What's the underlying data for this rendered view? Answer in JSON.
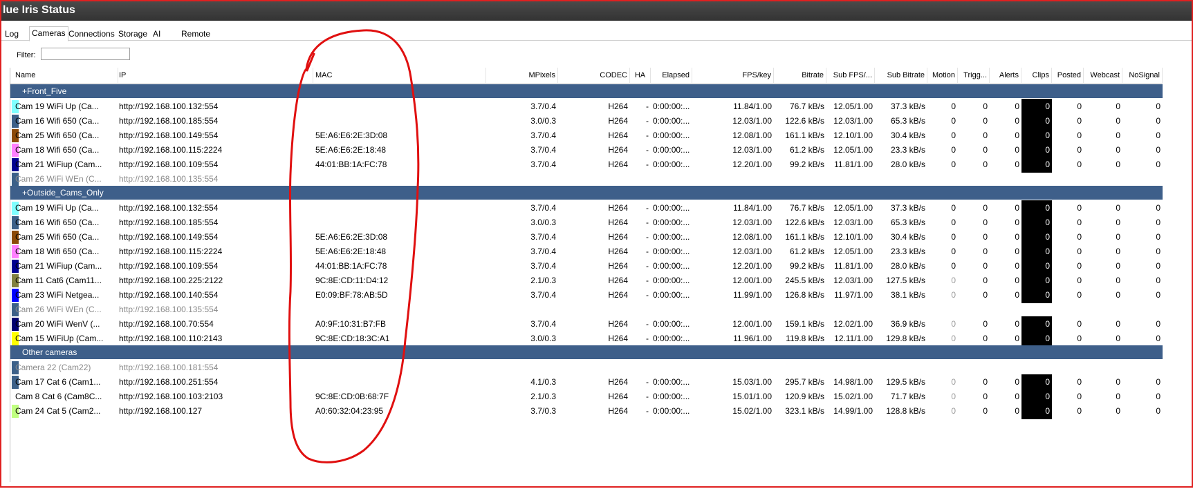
{
  "window": {
    "title": "lue Iris Status"
  },
  "tabs": [
    {
      "label": "Log",
      "active": false
    },
    {
      "label": "Cameras",
      "active": true
    },
    {
      "label": "Connections",
      "active": false
    },
    {
      "label": "Storage",
      "active": false
    },
    {
      "label": "AI",
      "active": false
    },
    {
      "label": "Remote",
      "active": false
    }
  ],
  "filter": {
    "label": "Filter:",
    "value": ""
  },
  "columns": [
    "Name",
    "IP",
    "MAC",
    "MPixels",
    "CODEC",
    "HA",
    "Elapsed",
    "FPS/key",
    "Bitrate",
    "Sub FPS/...",
    "Sub Bitrate",
    "Motion",
    "Trigg...",
    "Alerts",
    "Clips",
    "Posted",
    "Webcast",
    "NoSignal"
  ],
  "groups": [
    {
      "label": "+Front_Five",
      "rows": [
        {
          "color": "#80ffff",
          "disabled": false,
          "name": "Cam 19 WiFi Up (Ca...",
          "ip": "http://192.168.100.132:554",
          "mac": "",
          "mpixels": "3.7/0.4",
          "codec": "H264",
          "ha": "-",
          "elapsed": "0:00:00:...",
          "fps": "11.84/1.00",
          "bitrate": "76.7 kB/s",
          "subfps": "12.05/1.00",
          "subbitrate": "37.3 kB/s",
          "motion": "0",
          "trigg": "0",
          "alerts": "0",
          "clips": "0",
          "posted": "0",
          "webcast": "0",
          "nosignal": "0",
          "dim_motion": false
        },
        {
          "color": "#3c6088",
          "disabled": false,
          "name": "Cam 16 Wifi 650 (Ca...",
          "ip": "http://192.168.100.185:554",
          "mac": "",
          "mpixels": "3.0/0.3",
          "codec": "H264",
          "ha": "-",
          "elapsed": "0:00:00:...",
          "fps": "12.03/1.00",
          "bitrate": "122.6 kB/s",
          "subfps": "12.03/1.00",
          "subbitrate": "65.3 kB/s",
          "motion": "0",
          "trigg": "0",
          "alerts": "0",
          "clips": "0",
          "posted": "0",
          "webcast": "0",
          "nosignal": "0",
          "dim_motion": false
        },
        {
          "color": "#8b4a08",
          "disabled": false,
          "name": "Cam 25 Wifi 650 (Ca...",
          "ip": "http://192.168.100.149:554",
          "mac": "5E:A6:E6:2E:3D:08",
          "mpixels": "3.7/0.4",
          "codec": "H264",
          "ha": "-",
          "elapsed": "0:00:00:...",
          "fps": "12.08/1.00",
          "bitrate": "161.1 kB/s",
          "subfps": "12.10/1.00",
          "subbitrate": "30.4 kB/s",
          "motion": "0",
          "trigg": "0",
          "alerts": "0",
          "clips": "0",
          "posted": "0",
          "webcast": "0",
          "nosignal": "0",
          "dim_motion": false
        },
        {
          "color": "#ff80ff",
          "disabled": false,
          "name": "Cam 18 Wifi 650 (Ca...",
          "ip": "http://192.168.100.115:2224",
          "mac": "5E:A6:E6:2E:18:48",
          "mpixels": "3.7/0.4",
          "codec": "H264",
          "ha": "-",
          "elapsed": "0:00:00:...",
          "fps": "12.03/1.00",
          "bitrate": "61.2 kB/s",
          "subfps": "12.05/1.00",
          "subbitrate": "23.3 kB/s",
          "motion": "0",
          "trigg": "0",
          "alerts": "0",
          "clips": "0",
          "posted": "0",
          "webcast": "0",
          "nosignal": "0",
          "dim_motion": false
        },
        {
          "color": "#000090",
          "disabled": false,
          "name": "Cam 21 WiFiup (Cam...",
          "ip": "http://192.168.100.109:554",
          "mac": "44:01:BB:1A:FC:78",
          "mpixels": "3.7/0.4",
          "codec": "H264",
          "ha": "-",
          "elapsed": "0:00:00:...",
          "fps": "12.20/1.00",
          "bitrate": "99.2 kB/s",
          "subfps": "11.81/1.00",
          "subbitrate": "28.0 kB/s",
          "motion": "0",
          "trigg": "0",
          "alerts": "0",
          "clips": "0",
          "posted": "0",
          "webcast": "0",
          "nosignal": "0",
          "dim_motion": false
        },
        {
          "color": "#3c6088",
          "disabled": true,
          "name": "Cam 26 WiFi WEn (C...",
          "ip": "http://192.168.100.135:554",
          "mac": "",
          "mpixels": "",
          "codec": "",
          "ha": "",
          "elapsed": "",
          "fps": "",
          "bitrate": "",
          "subfps": "",
          "subbitrate": "",
          "motion": "",
          "trigg": "",
          "alerts": "",
          "clips": "",
          "posted": "",
          "webcast": "",
          "nosignal": "",
          "dim_motion": false
        }
      ]
    },
    {
      "label": "+Outside_Cams_Only",
      "rows": [
        {
          "color": "#80ffff",
          "disabled": false,
          "name": "Cam 19 WiFi Up (Ca...",
          "ip": "http://192.168.100.132:554",
          "mac": "",
          "mpixels": "3.7/0.4",
          "codec": "H264",
          "ha": "-",
          "elapsed": "0:00:00:...",
          "fps": "11.84/1.00",
          "bitrate": "76.7 kB/s",
          "subfps": "12.05/1.00",
          "subbitrate": "37.3 kB/s",
          "motion": "0",
          "trigg": "0",
          "alerts": "0",
          "clips": "0",
          "posted": "0",
          "webcast": "0",
          "nosignal": "0",
          "dim_motion": false
        },
        {
          "color": "#3c6088",
          "disabled": false,
          "name": "Cam 16 Wifi 650 (Ca...",
          "ip": "http://192.168.100.185:554",
          "mac": "",
          "mpixels": "3.0/0.3",
          "codec": "H264",
          "ha": "-",
          "elapsed": "0:00:00:...",
          "fps": "12.03/1.00",
          "bitrate": "122.6 kB/s",
          "subfps": "12.03/1.00",
          "subbitrate": "65.3 kB/s",
          "motion": "0",
          "trigg": "0",
          "alerts": "0",
          "clips": "0",
          "posted": "0",
          "webcast": "0",
          "nosignal": "0",
          "dim_motion": false
        },
        {
          "color": "#8b4a08",
          "disabled": false,
          "name": "Cam 25 Wifi 650 (Ca...",
          "ip": "http://192.168.100.149:554",
          "mac": "5E:A6:E6:2E:3D:08",
          "mpixels": "3.7/0.4",
          "codec": "H264",
          "ha": "-",
          "elapsed": "0:00:00:...",
          "fps": "12.08/1.00",
          "bitrate": "161.1 kB/s",
          "subfps": "12.10/1.00",
          "subbitrate": "30.4 kB/s",
          "motion": "0",
          "trigg": "0",
          "alerts": "0",
          "clips": "0",
          "posted": "0",
          "webcast": "0",
          "nosignal": "0",
          "dim_motion": false
        },
        {
          "color": "#ff80ff",
          "disabled": false,
          "name": "Cam 18 Wifi 650 (Ca...",
          "ip": "http://192.168.100.115:2224",
          "mac": "5E:A6:E6:2E:18:48",
          "mpixels": "3.7/0.4",
          "codec": "H264",
          "ha": "-",
          "elapsed": "0:00:00:...",
          "fps": "12.03/1.00",
          "bitrate": "61.2 kB/s",
          "subfps": "12.05/1.00",
          "subbitrate": "23.3 kB/s",
          "motion": "0",
          "trigg": "0",
          "alerts": "0",
          "clips": "0",
          "posted": "0",
          "webcast": "0",
          "nosignal": "0",
          "dim_motion": false
        },
        {
          "color": "#000090",
          "disabled": false,
          "name": "Cam 21 WiFiup (Cam...",
          "ip": "http://192.168.100.109:554",
          "mac": "44:01:BB:1A:FC:78",
          "mpixels": "3.7/0.4",
          "codec": "H264",
          "ha": "-",
          "elapsed": "0:00:00:...",
          "fps": "12.20/1.00",
          "bitrate": "99.2 kB/s",
          "subfps": "11.81/1.00",
          "subbitrate": "28.0 kB/s",
          "motion": "0",
          "trigg": "0",
          "alerts": "0",
          "clips": "0",
          "posted": "0",
          "webcast": "0",
          "nosignal": "0",
          "dim_motion": false
        },
        {
          "color": "#808040",
          "disabled": false,
          "name": "Cam 11 Cat6 (Cam11...",
          "ip": "http://192.168.100.225:2122",
          "mac": "9C:8E:CD:11:D4:12",
          "mpixels": "2.1/0.3",
          "codec": "H264",
          "ha": "-",
          "elapsed": "0:00:00:...",
          "fps": "12.00/1.00",
          "bitrate": "245.5 kB/s",
          "subfps": "12.03/1.00",
          "subbitrate": "127.5 kB/s",
          "motion": "0",
          "trigg": "0",
          "alerts": "0",
          "clips": "0",
          "posted": "0",
          "webcast": "0",
          "nosignal": "0",
          "dim_motion": true
        },
        {
          "color": "#0000ff",
          "disabled": false,
          "name": "Cam 23 WiFi Netgea...",
          "ip": "http://192.168.100.140:554",
          "mac": "E0:09:BF:78:AB:5D",
          "mpixels": "3.7/0.4",
          "codec": "H264",
          "ha": "-",
          "elapsed": "0:00:00:...",
          "fps": "11.99/1.00",
          "bitrate": "126.8 kB/s",
          "subfps": "11.97/1.00",
          "subbitrate": "38.1 kB/s",
          "motion": "0",
          "trigg": "0",
          "alerts": "0",
          "clips": "0",
          "posted": "0",
          "webcast": "0",
          "nosignal": "0",
          "dim_motion": true
        },
        {
          "color": "#3c6088",
          "disabled": true,
          "name": "Cam 26 WiFi WEn (C...",
          "ip": "http://192.168.100.135:554",
          "mac": "",
          "mpixels": "",
          "codec": "",
          "ha": "",
          "elapsed": "",
          "fps": "",
          "bitrate": "",
          "subfps": "",
          "subbitrate": "",
          "motion": "",
          "trigg": "",
          "alerts": "",
          "clips": "",
          "posted": "",
          "webcast": "",
          "nosignal": "",
          "dim_motion": false
        },
        {
          "color": "#000070",
          "disabled": false,
          "name": "Cam 20 WiFi WenV (...",
          "ip": "http://192.168.100.70:554",
          "mac": "A0:9F:10:31:B7:FB",
          "mpixels": "3.7/0.4",
          "codec": "H264",
          "ha": "-",
          "elapsed": "0:00:00:...",
          "fps": "12.00/1.00",
          "bitrate": "159.1 kB/s",
          "subfps": "12.02/1.00",
          "subbitrate": "36.9 kB/s",
          "motion": "0",
          "trigg": "0",
          "alerts": "0",
          "clips": "0",
          "posted": "0",
          "webcast": "0",
          "nosignal": "0",
          "dim_motion": true
        },
        {
          "color": "#ffff00",
          "disabled": false,
          "name": "Cam 15  WiFiUp (Cam...",
          "ip": "http://192.168.100.110:2143",
          "mac": "9C:8E:CD:18:3C:A1",
          "mpixels": "3.0/0.3",
          "codec": "H264",
          "ha": "-",
          "elapsed": "0:00:00:...",
          "fps": "11.96/1.00",
          "bitrate": "119.8 kB/s",
          "subfps": "12.11/1.00",
          "subbitrate": "129.8 kB/s",
          "motion": "0",
          "trigg": "0",
          "alerts": "0",
          "clips": "0",
          "posted": "0",
          "webcast": "0",
          "nosignal": "0",
          "dim_motion": true
        }
      ]
    },
    {
      "label": "Other cameras",
      "rows": [
        {
          "color": "#3c6088",
          "disabled": true,
          "name": "Camera 22 (Cam22)",
          "ip": "http://192.168.100.181:554",
          "mac": "",
          "mpixels": "",
          "codec": "",
          "ha": "",
          "elapsed": "",
          "fps": "",
          "bitrate": "",
          "subfps": "",
          "subbitrate": "",
          "motion": "",
          "trigg": "",
          "alerts": "",
          "clips": "",
          "posted": "",
          "webcast": "",
          "nosignal": "",
          "dim_motion": false
        },
        {
          "color": "#3c6088",
          "disabled": false,
          "name": "Cam 17 Cat 6 (Cam1...",
          "ip": "http://192.168.100.251:554",
          "mac": "",
          "mpixels": "4.1/0.3",
          "codec": "H264",
          "ha": "-",
          "elapsed": "0:00:00:...",
          "fps": "15.03/1.00",
          "bitrate": "295.7 kB/s",
          "subfps": "14.98/1.00",
          "subbitrate": "129.5 kB/s",
          "motion": "0",
          "trigg": "0",
          "alerts": "0",
          "clips": "0",
          "posted": "0",
          "webcast": "0",
          "nosignal": "0",
          "dim_motion": true
        },
        {
          "color": "#ffffff",
          "disabled": false,
          "name": "Cam 8 Cat 6 (Cam8C...",
          "ip": "http://192.168.100.103:2103",
          "mac": "9C:8E:CD:0B:68:7F",
          "mpixels": "2.1/0.3",
          "codec": "H264",
          "ha": "-",
          "elapsed": "0:00:00:...",
          "fps": "15.01/1.00",
          "bitrate": "120.9 kB/s",
          "subfps": "15.02/1.00",
          "subbitrate": "71.7 kB/s",
          "motion": "0",
          "trigg": "0",
          "alerts": "0",
          "clips": "0",
          "posted": "0",
          "webcast": "0",
          "nosignal": "0",
          "dim_motion": true
        },
        {
          "color": "#c0ff80",
          "disabled": false,
          "name": "Cam 24 Cat 5 (Cam2...",
          "ip": "http://192.168.100.127",
          "mac": "A0:60:32:04:23:95",
          "mpixels": "3.7/0.3",
          "codec": "H264",
          "ha": "-",
          "elapsed": "0:00:00:...",
          "fps": "15.02/1.00",
          "bitrate": "323.1 kB/s",
          "subfps": "14.99/1.00",
          "subbitrate": "128.8 kB/s",
          "motion": "0",
          "trigg": "0",
          "alerts": "0",
          "clips": "0",
          "posted": "0",
          "webcast": "0",
          "nosignal": "0",
          "dim_motion": true
        }
      ]
    }
  ],
  "colors": {
    "group_header_bg": "#3e5f8a",
    "annotation_stroke": "#e01010",
    "border": "#e02020"
  }
}
